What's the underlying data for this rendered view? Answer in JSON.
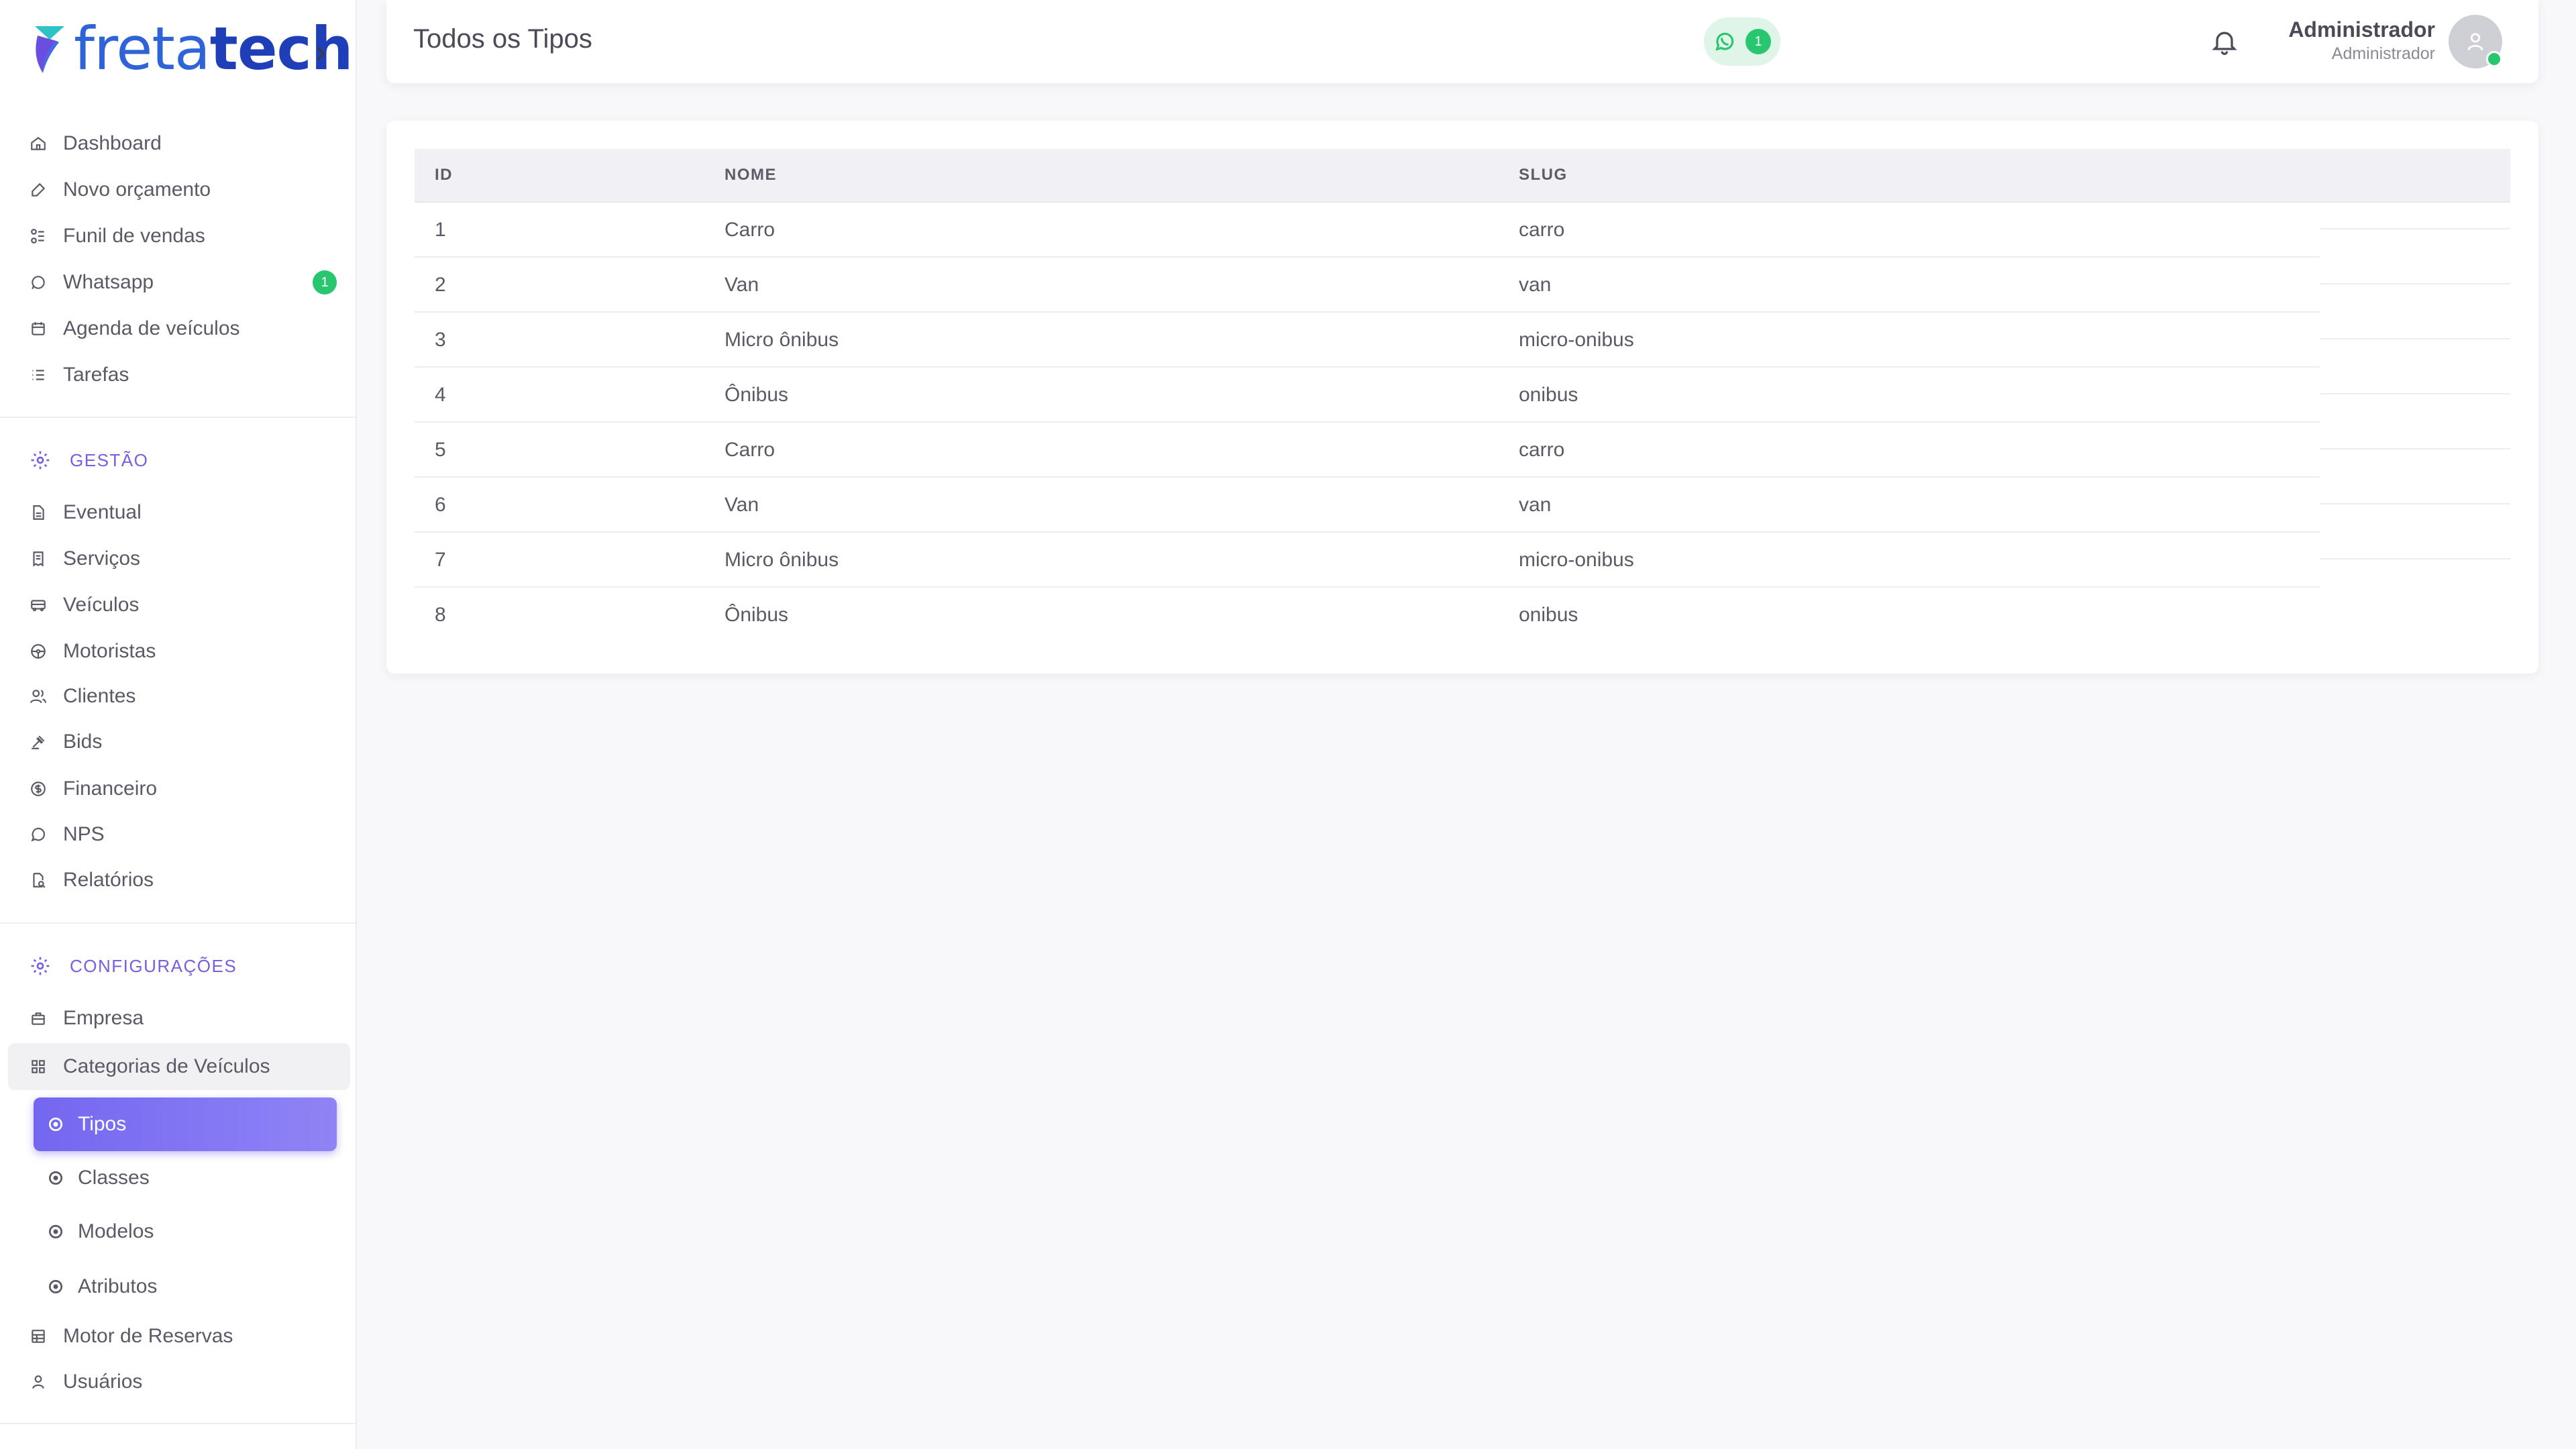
{
  "brand": {
    "part1": "freta",
    "part2": "tech"
  },
  "header": {
    "title": "Todos os Tipos",
    "whatsapp_count": "1",
    "user_name": "Administrador",
    "user_role": "Administrador"
  },
  "sidebar": {
    "main_items": [
      {
        "label": "Dashboard",
        "icon": "home-icon"
      },
      {
        "label": "Novo orçamento",
        "icon": "edit-icon"
      },
      {
        "label": "Funil de vendas",
        "icon": "funnel-icon"
      },
      {
        "label": "Whatsapp",
        "icon": "whatsapp-icon",
        "badge": "1"
      },
      {
        "label": "Agenda de veículos",
        "icon": "calendar-icon"
      },
      {
        "label": "Tarefas",
        "icon": "list-icon"
      }
    ],
    "section_gestao": "GESTÃO",
    "gestao_items": [
      {
        "label": "Eventual",
        "icon": "file-icon"
      },
      {
        "label": "Serviços",
        "icon": "receipt-icon"
      },
      {
        "label": "Veículos",
        "icon": "bus-icon"
      },
      {
        "label": "Motoristas",
        "icon": "steering-wheel-icon"
      },
      {
        "label": "Clientes",
        "icon": "users-icon"
      },
      {
        "label": "Bids",
        "icon": "gavel-icon"
      },
      {
        "label": "Financeiro",
        "icon": "coin-icon"
      },
      {
        "label": "NPS",
        "icon": "message-icon"
      },
      {
        "label": "Relatórios",
        "icon": "report-icon"
      }
    ],
    "section_config": "CONFIGURAÇÕES",
    "config_items": [
      {
        "label": "Empresa",
        "icon": "building-icon"
      },
      {
        "label": "Categorias de Veículos",
        "icon": "category-icon"
      }
    ],
    "sub_items": [
      {
        "label": "Tipos",
        "active": true
      },
      {
        "label": "Classes"
      },
      {
        "label": "Modelos"
      },
      {
        "label": "Atributos"
      }
    ],
    "bottom_items": [
      {
        "label": "Motor de Reservas",
        "icon": "table-icon"
      },
      {
        "label": "Usuários",
        "icon": "user-icon"
      }
    ]
  },
  "table": {
    "headers": {
      "id": "ID",
      "nome": "NOME",
      "slug": "SLUG"
    },
    "rows": [
      {
        "id": "1",
        "nome": "Carro",
        "slug": "carro"
      },
      {
        "id": "2",
        "nome": "Van",
        "slug": "van"
      },
      {
        "id": "3",
        "nome": "Micro ônibus",
        "slug": "micro-onibus"
      },
      {
        "id": "4",
        "nome": "Ônibus",
        "slug": "onibus"
      },
      {
        "id": "5",
        "nome": "Carro",
        "slug": "carro"
      },
      {
        "id": "6",
        "nome": "Van",
        "slug": "van"
      },
      {
        "id": "7",
        "nome": "Micro ônibus",
        "slug": "micro-onibus"
      },
      {
        "id": "8",
        "nome": "Ônibus",
        "slug": "onibus"
      }
    ]
  },
  "colors": {
    "accent": "#7367f0",
    "success": "#28c76f",
    "brand": "#2f63d8"
  }
}
